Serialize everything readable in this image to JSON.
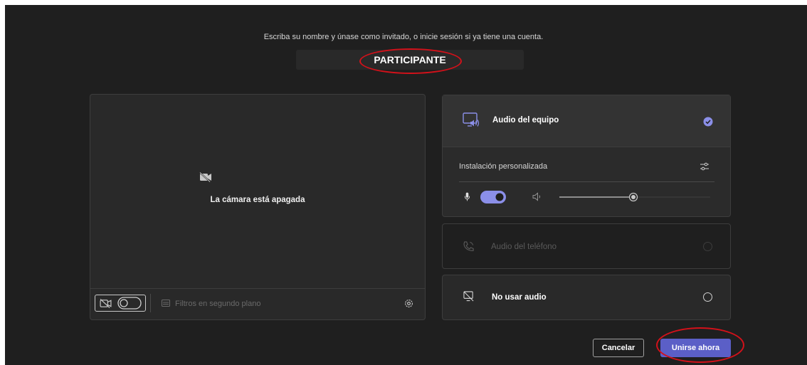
{
  "prompt": {
    "instructions": "Escriba su nombre y únase como invitado, o inicie sesión si ya tiene una cuenta.",
    "name_value": "PARTICIPANTE"
  },
  "video": {
    "camera_off_text": "La cámara está apagada",
    "filters_label": "Filtros en segundo plano",
    "camera_enabled": false
  },
  "audio": {
    "options": [
      {
        "label": "Audio del equipo",
        "selected": true,
        "icon": "computer-audio-icon"
      },
      {
        "label": "Audio del teléfono",
        "selected": false,
        "disabled": true,
        "icon": "phone-audio-icon"
      },
      {
        "label": "No usar audio",
        "selected": false,
        "icon": "no-audio-icon"
      }
    ],
    "custom_setup_label": "Instalación personalizada",
    "mic_enabled": true,
    "speaker_volume": 0.5
  },
  "actions": {
    "cancel_label": "Cancelar",
    "join_label": "Unirse ahora"
  },
  "colors": {
    "background": "#1f1f1f",
    "panel": "#292929",
    "accent": "#5b5fc7",
    "annotation_red": "#d3111a"
  }
}
